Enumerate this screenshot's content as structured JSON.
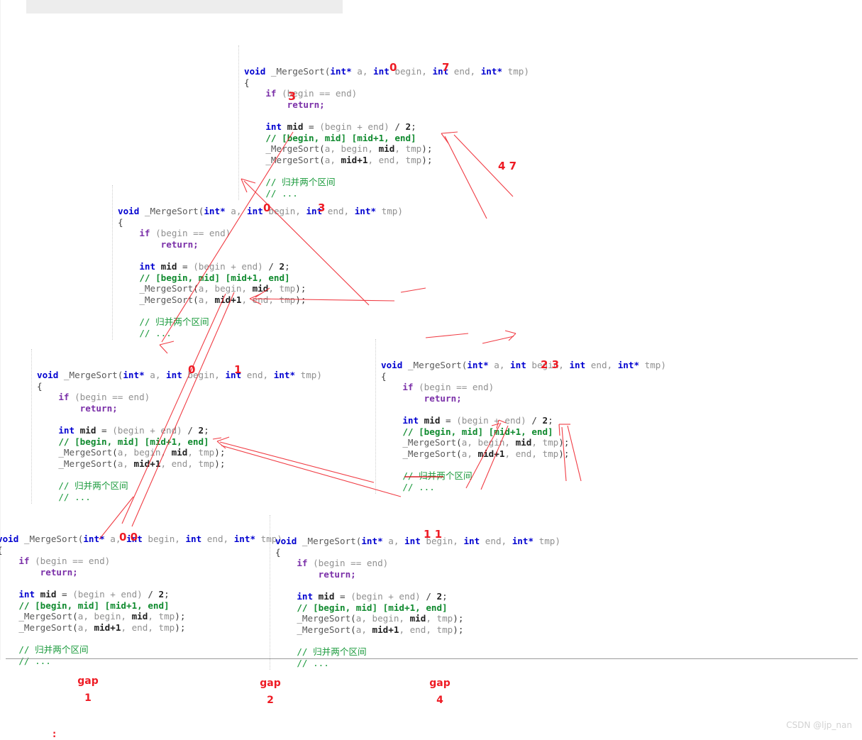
{
  "document": {
    "watermark": "CSDN @ljp_nan",
    "stray_mark": ":"
  },
  "code_template": {
    "line1_void": "void",
    "line1_name": " _MergeSort(",
    "line1_int1": "int*",
    "line1_a": " a, ",
    "line1_int2": "int",
    "line1_begin": " begin, ",
    "line1_int3": "int",
    "line1_end": " end, ",
    "line1_int4": "int*",
    "line1_tmp": " tmp)",
    "line2": "{",
    "line3_if": "if",
    "line3_rest": " (begin == end)",
    "line4_return": "return;",
    "line5": "",
    "line6_int": "int",
    "line6_rest": " mid = (begin + end) / 2;",
    "line7_cmt": "// [begin, mid] [mid+1, end]",
    "line8": "_MergeSort(a, begin, mid, tmp);",
    "line9": "_MergeSort(a, mid+1, end, tmp);",
    "line10": "",
    "line11_cmt": "// 归并两个区间",
    "line12_cmt": "// ..."
  },
  "blocks": [
    {
      "id": "block-root",
      "level": 0,
      "range": {
        "begin": "0",
        "end": "7"
      },
      "extra_label": "3",
      "note": "root call covering indices 0..7, mid annotated as 3"
    },
    {
      "id": "block-left-0-3",
      "level": 1,
      "range": {
        "begin": "0",
        "end": "3"
      },
      "note": "left half of root"
    },
    {
      "id": "block-right-4-7",
      "level": 1,
      "range": {
        "begin": "4",
        "end": "7"
      },
      "note": "right half of root, label drawn to the right of root block"
    },
    {
      "id": "block-left-0-1",
      "level": 2,
      "range": {
        "begin": "0",
        "end": "1"
      },
      "note": "left half of 0..3"
    },
    {
      "id": "block-right-2-3",
      "level": 2,
      "range": {
        "begin": "2",
        "end": "3"
      },
      "note": "right half of 0..3"
    },
    {
      "id": "block-leaf-0-0",
      "level": 3,
      "range": {
        "begin": "0",
        "end": "0"
      },
      "note": "leaf, returns immediately"
    },
    {
      "id": "block-leaf-1-1",
      "level": 3,
      "range": {
        "begin": "1",
        "end": "1"
      },
      "note": "leaf, returns immediately"
    }
  ],
  "annotations": {
    "root_begin": "0",
    "root_end": "7",
    "root_mid": "3",
    "right_half_label": "4 7",
    "lvl1_begin": "0",
    "lvl1_end": "3",
    "lvl2_left_begin": "0",
    "lvl2_left_end": "1",
    "lvl2_right": "2 3",
    "leaf_left": "0 0",
    "leaf_right": "1 1"
  },
  "gap_legend": [
    {
      "label": "gap",
      "value": "1"
    },
    {
      "label": "gap",
      "value": "2"
    },
    {
      "label": "gap",
      "value": "4"
    }
  ],
  "colors": {
    "annotation_red": "#ee1b24",
    "keyword_blue": "#0000d0",
    "keyword_purple": "#7a2fa8",
    "comment_green": "#1a9a3c",
    "identifier_gray": "#909090",
    "topbar_gray": "#ededed",
    "divider_gray": "#9a9a9a",
    "watermark_gray": "#d2d2d2"
  }
}
